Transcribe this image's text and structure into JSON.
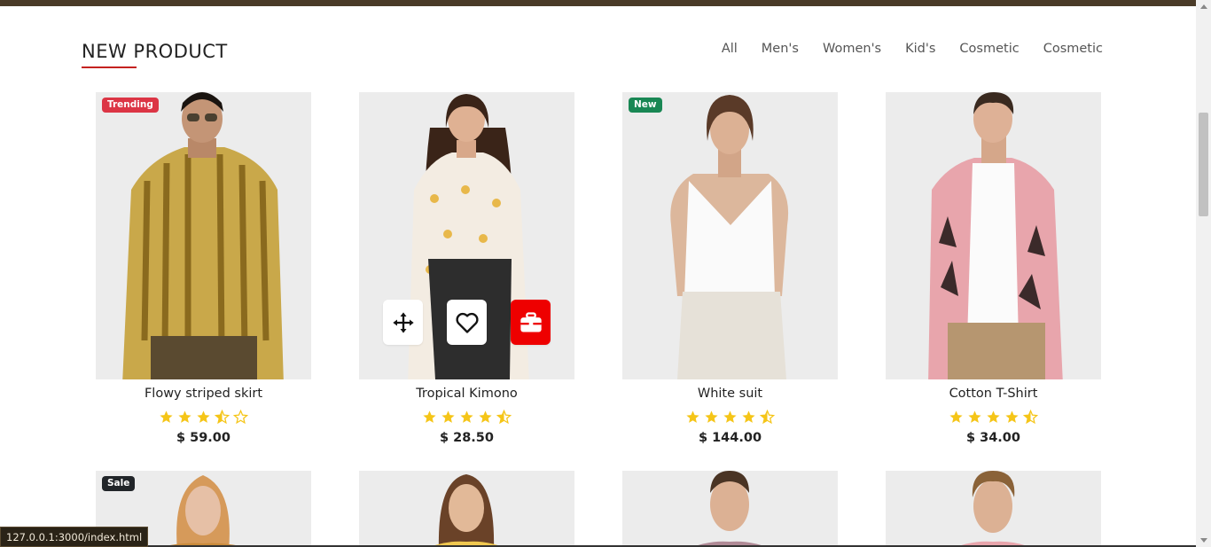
{
  "header": {
    "title": "NEW PRODUCT"
  },
  "filters": [
    "All",
    "Men's",
    "Women's",
    "Kid's",
    "Cosmetic",
    "Cosmetic"
  ],
  "products": [
    {
      "name": "Flowy striped skirt",
      "price": "$ 59.00",
      "rating": 3.5,
      "badge": "Trending",
      "badge_color": "#dc3545"
    },
    {
      "name": "Tropical Kimono",
      "price": "$ 28.50",
      "rating": 4.5,
      "badge": "",
      "badge_color": ""
    },
    {
      "name": "White suit",
      "price": "$ 144.00",
      "rating": 4.5,
      "badge": "New",
      "badge_color": "#198754"
    },
    {
      "name": "Cotton T-Shirt",
      "price": "$ 34.00",
      "rating": 4.5,
      "badge": "",
      "badge_color": ""
    }
  ],
  "second_row": [
    {
      "badge": "Sale",
      "badge_color": "#212529"
    },
    {
      "badge": "",
      "badge_color": ""
    },
    {
      "badge": "",
      "badge_color": ""
    },
    {
      "badge": "",
      "badge_color": ""
    }
  ],
  "hover_actions": [
    "move-icon",
    "heart-icon",
    "briefcase-icon"
  ],
  "colors": {
    "accent": "#c5221f",
    "star": "#f5c518",
    "cart_button": "#ee0000",
    "topbar": "#4a3b28"
  },
  "status_url": "127.0.0.1:3000/index.html"
}
